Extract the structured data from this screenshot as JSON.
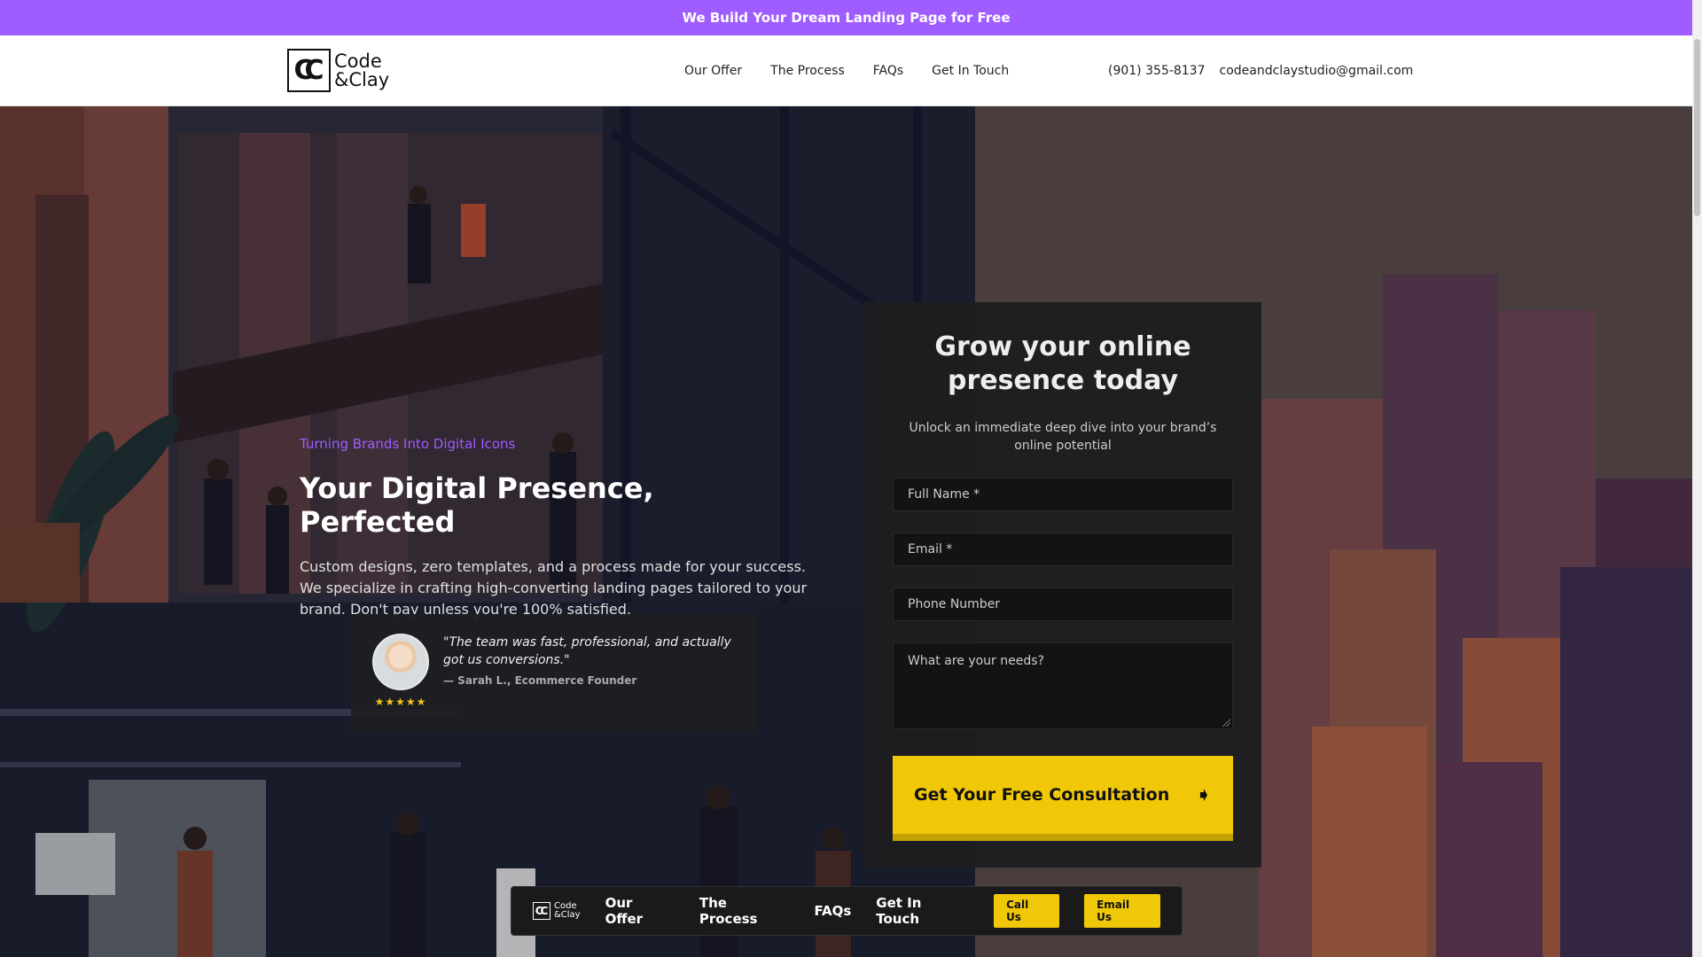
{
  "promo": {
    "text": "We Build Your Dream Landing Page for Free"
  },
  "header": {
    "logo_mark": "CC",
    "logo_line1": "Code",
    "logo_line2": "&Clay",
    "nav": [
      "Our Offer",
      "The Process",
      "FAQs",
      "Get In Touch"
    ],
    "phone": "(901) 355-8137",
    "email": "codeandclaystudio@gmail.com"
  },
  "hero": {
    "tagline": "Turning Brands Into Digital Icons",
    "headline": "Your Digital Presence, Perfected",
    "description": "Custom designs, zero templates, and a process made for your success. We specialize in crafting high-converting landing pages tailored to your brand. Don't pay unless you're 100% satisfied."
  },
  "testimonial": {
    "quote": "\"The team was fast, professional, and actually got us conversions.\"",
    "author": "— Sarah L., Ecommerce Founder",
    "stars": "★★★★★"
  },
  "form": {
    "title": "Grow your online presence today",
    "subtitle": "Unlock an immediate deep dive into your brand’s online potential",
    "full_name_placeholder": "Full Name *",
    "email_placeholder": "Email *",
    "phone_placeholder": "Phone Number",
    "needs_placeholder": "What are your needs?",
    "cta_label": "Get Your Free Consultation",
    "cta_icon": "arrow-icon"
  },
  "bottom_nav": {
    "logo_line1": "Code",
    "logo_line2": "&Clay",
    "links": [
      "Our Offer",
      "The Process",
      "FAQs",
      "Get In Touch"
    ],
    "call_label": "Call Us",
    "email_label": "Email Us"
  },
  "colors": {
    "accent": "#9f5cff",
    "cta": "#f0c808"
  }
}
